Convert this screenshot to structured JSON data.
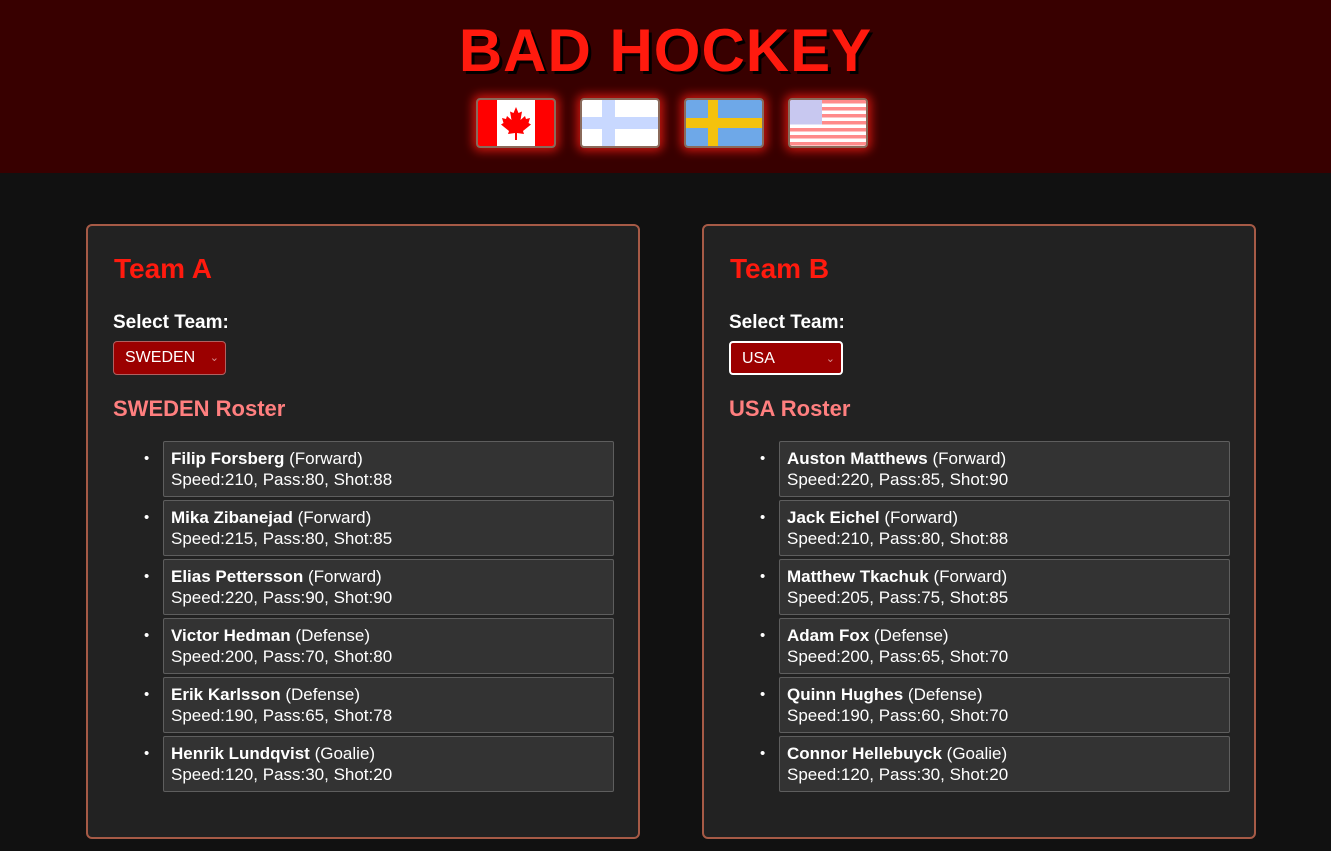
{
  "header": {
    "title": "BAD HOCKEY",
    "flags": [
      {
        "icon": "canada-flag-icon"
      },
      {
        "icon": "finland-flag-icon"
      },
      {
        "icon": "sweden-flag-icon"
      },
      {
        "icon": "usa-flag-icon"
      }
    ]
  },
  "colors": {
    "header_bg": "#380000",
    "page_bg": "#111111",
    "title": "#ff1a0e",
    "panel_bg": "#222222",
    "panel_border": "#a65a46",
    "select_bg": "#9b0000",
    "roster_title": "#ff7f7f"
  },
  "team_a": {
    "title": "Team A",
    "select_label": "Select Team:",
    "selected": "SWEDEN",
    "roster_title": "SWEDEN Roster",
    "players": [
      {
        "name": "Filip Forsberg",
        "position": "(Forward)",
        "stats": "Speed:210, Pass:80, Shot:88"
      },
      {
        "name": "Mika Zibanejad",
        "position": "(Forward)",
        "stats": "Speed:215, Pass:80, Shot:85"
      },
      {
        "name": "Elias Pettersson",
        "position": "(Forward)",
        "stats": "Speed:220, Pass:90, Shot:90"
      },
      {
        "name": "Victor Hedman",
        "position": "(Defense)",
        "stats": "Speed:200, Pass:70, Shot:80"
      },
      {
        "name": "Erik Karlsson",
        "position": "(Defense)",
        "stats": "Speed:190, Pass:65, Shot:78"
      },
      {
        "name": "Henrik Lundqvist",
        "position": "(Goalie)",
        "stats": "Speed:120, Pass:30, Shot:20"
      }
    ]
  },
  "team_b": {
    "title": "Team B",
    "select_label": "Select Team:",
    "selected": "USA",
    "roster_title": "USA Roster",
    "players": [
      {
        "name": "Auston Matthews",
        "position": "(Forward)",
        "stats": "Speed:220, Pass:85, Shot:90"
      },
      {
        "name": "Jack Eichel",
        "position": "(Forward)",
        "stats": "Speed:210, Pass:80, Shot:88"
      },
      {
        "name": "Matthew Tkachuk",
        "position": "(Forward)",
        "stats": "Speed:205, Pass:75, Shot:85"
      },
      {
        "name": "Adam Fox",
        "position": "(Defense)",
        "stats": "Speed:200, Pass:65, Shot:70"
      },
      {
        "name": "Quinn Hughes",
        "position": "(Defense)",
        "stats": "Speed:190, Pass:60, Shot:70"
      },
      {
        "name": "Connor Hellebuyck",
        "position": "(Goalie)",
        "stats": "Speed:120, Pass:30, Shot:20"
      }
    ]
  }
}
